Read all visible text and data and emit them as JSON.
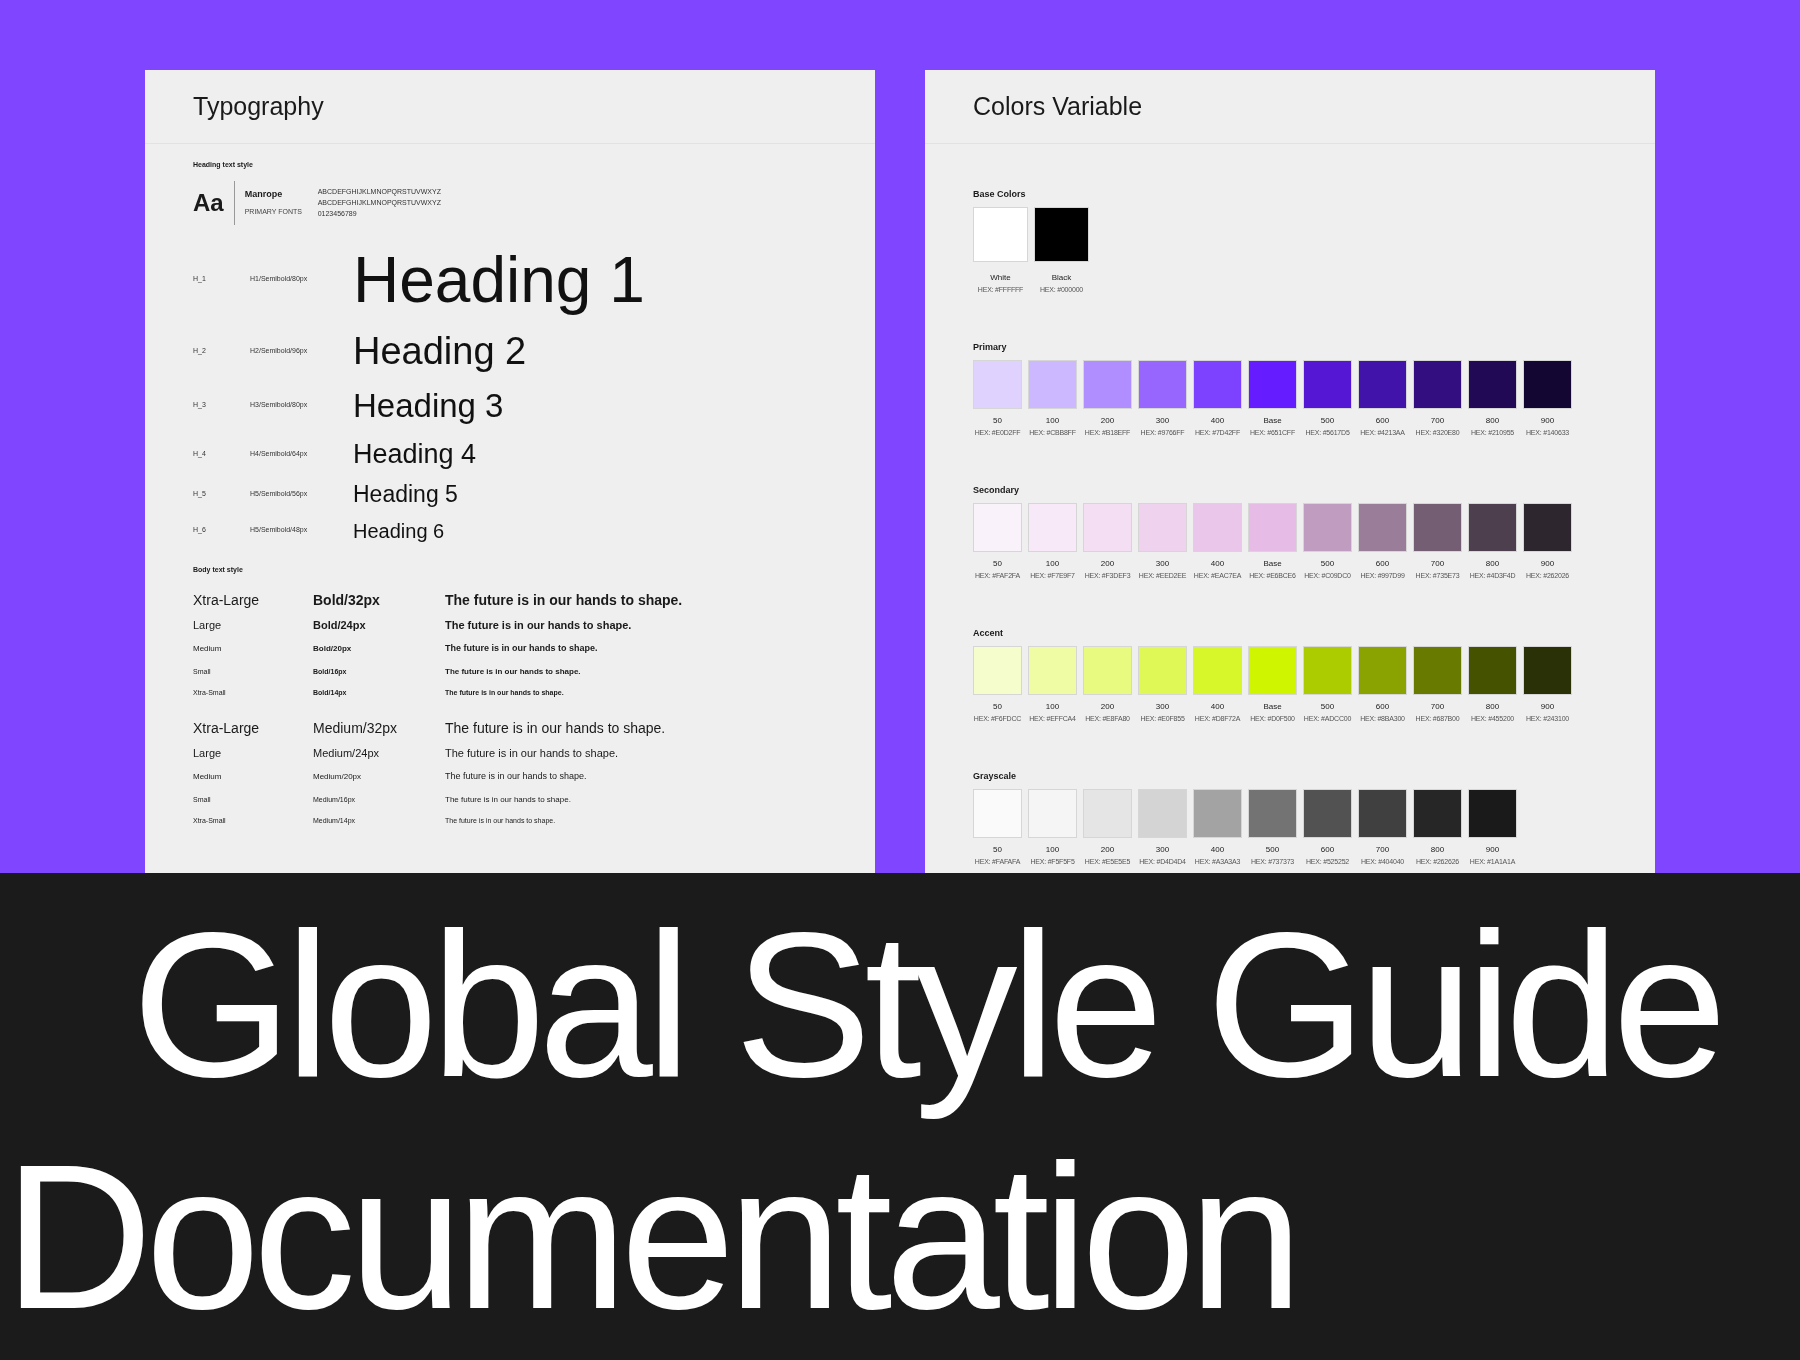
{
  "typography": {
    "title": "Typography",
    "heading_label": "Heading text style",
    "font_sample": {
      "glyph": "Aa",
      "name": "Manrope",
      "category": "PRIMARY FONTS",
      "lines": [
        "ABCDEFGHIJKLMNOPQRSTUVWXYZ",
        "ABCDEFGHIJKLMNOPQRSTUVWXYZ",
        "0123456789"
      ]
    },
    "headings": [
      {
        "tag": "H_1",
        "spec": "H1/Semibold/80px",
        "text": "Heading 1"
      },
      {
        "tag": "H_2",
        "spec": "H2/Semibold/96px",
        "text": "Heading 2"
      },
      {
        "tag": "H_3",
        "spec": "H3/Semibold/80px",
        "text": "Heading 3"
      },
      {
        "tag": "H_4",
        "spec": "H4/Semibold/64px",
        "text": "Heading 4"
      },
      {
        "tag": "H_5",
        "spec": "H5/Semibold/56px",
        "text": "Heading 5"
      },
      {
        "tag": "H_6",
        "spec": "H5/Semibold/48px",
        "text": "Heading 6"
      }
    ],
    "body_label": "Body text style",
    "body_groups": [
      [
        {
          "size": "Xtra-Large",
          "spec": "Bold/32px",
          "sample": "The future is in our hands to shape."
        },
        {
          "size": "Large",
          "spec": "Bold/24px",
          "sample": "The future is in our hands to shape."
        },
        {
          "size": "Medium",
          "spec": "Bold/20px",
          "sample": "The future is in our hands to shape."
        },
        {
          "size": "Small",
          "spec": "Bold/16px",
          "sample": "The future is in our hands to shape."
        },
        {
          "size": "Xtra-Small",
          "spec": "Bold/14px",
          "sample": "The future is in our hands to shape."
        }
      ],
      [
        {
          "size": "Xtra-Large",
          "spec": "Medium/32px",
          "sample": "The future is in our hands to shape."
        },
        {
          "size": "Large",
          "spec": "Medium/24px",
          "sample": "The future is in our hands to shape."
        },
        {
          "size": "Medium",
          "spec": "Medium/20px",
          "sample": "The future is in our hands to shape."
        },
        {
          "size": "Small",
          "spec": "Medium/16px",
          "sample": "The future is in our hands to shape."
        },
        {
          "size": "Xtra-Small",
          "spec": "Medium/14px",
          "sample": "The future is in our hands to shape."
        }
      ]
    ]
  },
  "colors": {
    "title": "Colors Variable",
    "groups": [
      {
        "name": "Base Colors",
        "kind": "base",
        "swatches": [
          {
            "label": "White",
            "hex": "HEX: #FFFFFF",
            "color": "#ffffff"
          },
          {
            "label": "Black",
            "hex": "HEX: #000000",
            "color": "#000000"
          }
        ]
      },
      {
        "name": "Primary",
        "kind": "scale",
        "swatches": [
          {
            "label": "50",
            "hex": "HEX: #E0D2FF",
            "color": "#e0d2ff"
          },
          {
            "label": "100",
            "hex": "HEX: #CBB8FF",
            "color": "#cbb8ff"
          },
          {
            "label": "200",
            "hex": "HEX: #B18EFF",
            "color": "#b18eff"
          },
          {
            "label": "300",
            "hex": "HEX: #9766FF",
            "color": "#9766ff"
          },
          {
            "label": "400",
            "hex": "HEX: #7D42FF",
            "color": "#7d42ff"
          },
          {
            "label": "Base",
            "hex": "HEX: #651CFF",
            "color": "#651cff"
          },
          {
            "label": "500",
            "hex": "HEX: #5617D5",
            "color": "#5617d5"
          },
          {
            "label": "600",
            "hex": "HEX: #4213AA",
            "color": "#4213aa"
          },
          {
            "label": "700",
            "hex": "HEX: #320E80",
            "color": "#320e80"
          },
          {
            "label": "800",
            "hex": "HEX: #210955",
            "color": "#210955"
          },
          {
            "label": "900",
            "hex": "HEX: #140633",
            "color": "#140633"
          }
        ]
      },
      {
        "name": "Secondary",
        "kind": "scale",
        "swatches": [
          {
            "label": "50",
            "hex": "HEX: #FAF2FA",
            "color": "#faf2fa"
          },
          {
            "label": "100",
            "hex": "HEX: #F7E9F7",
            "color": "#f7e9f7"
          },
          {
            "label": "200",
            "hex": "HEX: #F3DEF3",
            "color": "#f3def3"
          },
          {
            "label": "300",
            "hex": "HEX: #EED2EE",
            "color": "#eed2ee"
          },
          {
            "label": "400",
            "hex": "HEX: #EAC7EA",
            "color": "#eac7ea"
          },
          {
            "label": "Base",
            "hex": "HEX: #E6BCE6",
            "color": "#e6bce6"
          },
          {
            "label": "500",
            "hex": "HEX: #C09DC0",
            "color": "#c09dc0"
          },
          {
            "label": "600",
            "hex": "HEX: #997D99",
            "color": "#997d99"
          },
          {
            "label": "700",
            "hex": "HEX: #735E73",
            "color": "#735e73"
          },
          {
            "label": "800",
            "hex": "HEX: #4D3F4D",
            "color": "#4d3f4d"
          },
          {
            "label": "900",
            "hex": "HEX: #262026",
            "color": "#2e262e"
          }
        ]
      },
      {
        "name": "Accent",
        "kind": "scale",
        "swatches": [
          {
            "label": "50",
            "hex": "HEX: #F6FDCC",
            "color": "#f6fdcc"
          },
          {
            "label": "100",
            "hex": "HEX: #EFFCA4",
            "color": "#effca4"
          },
          {
            "label": "200",
            "hex": "HEX: #E8FA80",
            "color": "#e8fa80"
          },
          {
            "label": "300",
            "hex": "HEX: #E0F855",
            "color": "#e0f855"
          },
          {
            "label": "400",
            "hex": "HEX: #D8F72A",
            "color": "#d8f72a"
          },
          {
            "label": "Base",
            "hex": "HEX: #D0F500",
            "color": "#d0f500"
          },
          {
            "label": "500",
            "hex": "HEX: #ADCC00",
            "color": "#adcc00"
          },
          {
            "label": "600",
            "hex": "HEX: #8BA300",
            "color": "#8ba300"
          },
          {
            "label": "700",
            "hex": "HEX: #687B00",
            "color": "#687b00"
          },
          {
            "label": "800",
            "hex": "HEX: #455200",
            "color": "#455200"
          },
          {
            "label": "900",
            "hex": "HEX: #243100",
            "color": "#2a3106"
          }
        ]
      },
      {
        "name": "Grayscale",
        "kind": "scale",
        "swatches": [
          {
            "label": "50",
            "hex": "HEX: #FAFAFA",
            "color": "#fafafa"
          },
          {
            "label": "100",
            "hex": "HEX: #F5F5F5",
            "color": "#f5f5f5"
          },
          {
            "label": "200",
            "hex": "HEX: #E5E5E5",
            "color": "#e5e5e5"
          },
          {
            "label": "300",
            "hex": "HEX: #D4D4D4",
            "color": "#d4d4d4"
          },
          {
            "label": "400",
            "hex": "HEX: #A3A3A3",
            "color": "#a3a3a3"
          },
          {
            "label": "500",
            "hex": "HEX: #737373",
            "color": "#737373"
          },
          {
            "label": "600",
            "hex": "HEX: #525252",
            "color": "#525252"
          },
          {
            "label": "700",
            "hex": "HEX: #404040",
            "color": "#404040"
          },
          {
            "label": "800",
            "hex": "HEX: #262626",
            "color": "#262626"
          },
          {
            "label": "900",
            "hex": "HEX: #1A1A1A",
            "color": "#1a1a1a"
          }
        ]
      }
    ]
  },
  "headline": {
    "lines": [
      "Global Style Guide",
      "Documentation"
    ]
  }
}
